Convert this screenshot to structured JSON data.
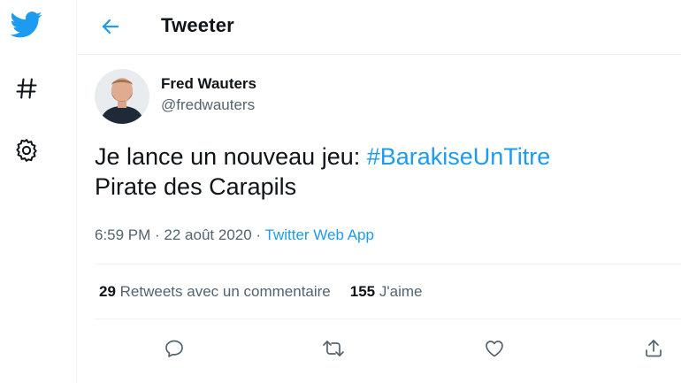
{
  "header": {
    "title": "Tweeter"
  },
  "tweet": {
    "author_name": "Fred Wauters",
    "author_handle": "@fredwauters",
    "text_prefix": "Je lance un nouveau jeu: ",
    "hashtag": "#BarakiseUnTitre",
    "text_line2": "Pirate des Carapils",
    "time": "6:59 PM",
    "separator": " · ",
    "date": "22 août 2020",
    "app": "Twitter Web App"
  },
  "stats": {
    "quote_count": "29",
    "quote_label": "Retweets avec un commentaire",
    "like_count": "155",
    "like_label": "J'aime"
  },
  "icons": {
    "nav": [
      "twitter-logo-icon",
      "hashtag-icon",
      "gear-icon"
    ],
    "back": "arrow-left-icon",
    "actions": [
      "reply-icon",
      "retweet-icon",
      "like-icon",
      "share-icon"
    ]
  },
  "colors": {
    "accent": "#1d9bf0",
    "muted": "#536471",
    "text": "#0f1419"
  }
}
